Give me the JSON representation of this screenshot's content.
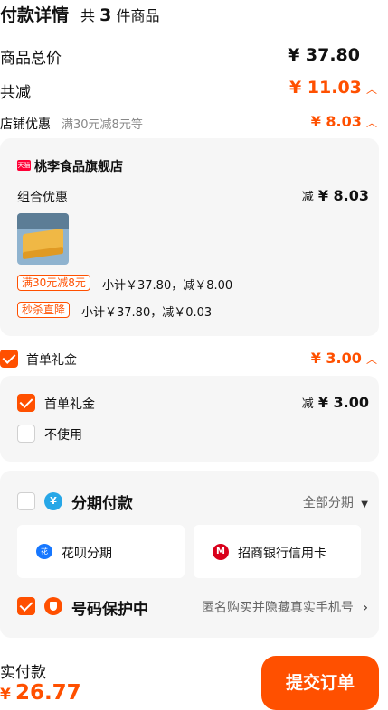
{
  "header": {
    "title": "付款详情",
    "count_prefix": "共",
    "count": "3",
    "count_suffix": "件商品"
  },
  "summary": {
    "total_label": "商品总价",
    "total_value": "¥ 37.80",
    "discount_label": "共减",
    "discount_value": "¥ 11.03",
    "shop_label": "店铺优惠",
    "shop_note": "满30元减8元等",
    "shop_value": "¥ 8.03"
  },
  "shop": {
    "badge": "天猫",
    "name": "桃李食品旗舰店",
    "combo_label": "组合优惠",
    "combo_prefix": "减",
    "combo_value": "¥ 8.03",
    "promos": [
      {
        "tag": "满30元减8元",
        "text": "小计￥37.80，减￥8.00"
      },
      {
        "tag": "秒杀直降",
        "text": "小计￥37.80，减￥0.03"
      }
    ]
  },
  "gift": {
    "label": "首单礼金",
    "value": "¥ 3.00",
    "options": [
      {
        "label": "首单礼金",
        "prefix": "减",
        "value": "¥ 3.00",
        "checked": true
      },
      {
        "label": "不使用",
        "checked": false
      }
    ]
  },
  "installment": {
    "title": "分期付款",
    "link": "全部分期",
    "methods": [
      {
        "label": "花呗分期"
      },
      {
        "label": "招商银行信用卡"
      }
    ]
  },
  "privacy": {
    "title": "号码保护中",
    "desc": "匿名购买并隐藏真实手机号",
    "checked": true
  },
  "footer": {
    "label": "实付款",
    "currency": "¥",
    "amount": "26.77",
    "submit": "提交订单"
  },
  "colors": {
    "accent": "#ff5000",
    "card_bg": "#f6f6f6"
  }
}
